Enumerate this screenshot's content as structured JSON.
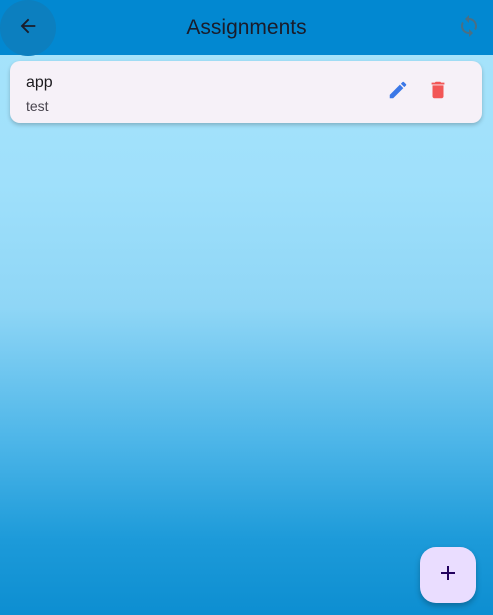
{
  "app_bar": {
    "title": "Assignments",
    "back_icon": "arrow-back-icon",
    "refresh_icon": "sync-icon",
    "background_color": "#0288d1"
  },
  "assignments": [
    {
      "title": "app",
      "subtitle": "test",
      "edit_icon": "edit-pencil-icon",
      "delete_icon": "trash-icon",
      "edit_color": "#3b78e7",
      "delete_color": "#f25656"
    }
  ],
  "fab": {
    "icon": "add-icon",
    "color": "#eaddff"
  }
}
